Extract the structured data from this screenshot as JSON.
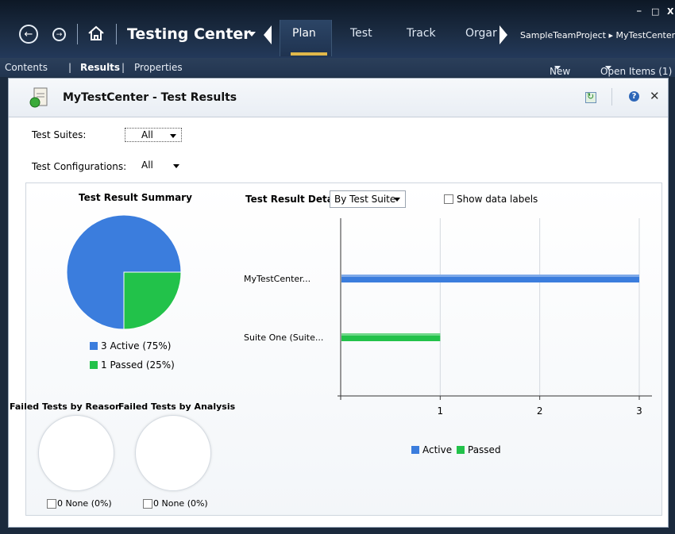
{
  "window": {
    "app_title": "Testing Center",
    "tabs": [
      {
        "label": "Plan",
        "active": true
      },
      {
        "label": "Test",
        "active": false
      },
      {
        "label": "Track",
        "active": false
      },
      {
        "label": "Orgar",
        "active": false
      }
    ],
    "breadcrumb": "SampleTeamProject ▸ MyTestCenter",
    "controls": {
      "minimize": "_",
      "maximize": "□",
      "close": "X"
    }
  },
  "subnav": {
    "items": [
      "Contents",
      "Results",
      "Properties"
    ],
    "selected": "Results",
    "new_label": "New",
    "open_items_label": "Open Items (1)"
  },
  "panel": {
    "title": "MyTestCenter - Test Results"
  },
  "filters": {
    "test_suites_label": "Test Suites:",
    "test_suites_value": "All",
    "test_configurations_label": "Test Configurations:",
    "test_configurations_value": "All"
  },
  "summary": {
    "title": "Test Result Summary",
    "legend": [
      {
        "label": "3 Active (75%)",
        "color": "#3b7ddd"
      },
      {
        "label": "1 Passed (25%)",
        "color": "#22c24a"
      }
    ]
  },
  "details": {
    "title": "Test Result Details",
    "group_by": "By Test Suite",
    "show_data_labels": "Show data labels",
    "legend": [
      {
        "label": "Active",
        "color": "#3b7ddd"
      },
      {
        "label": "Passed",
        "color": "#22c24a"
      }
    ]
  },
  "failed": {
    "by_reason_title": "Failed Tests by Reason",
    "by_analysis_title": "Failed Tests by Analysis",
    "by_reason_legend": "0 None (0%)",
    "by_analysis_legend": "0 None (0%)"
  },
  "chart_data": [
    {
      "type": "pie",
      "title": "Test Result Summary",
      "labels": [
        "Active",
        "Passed"
      ],
      "values": [
        3,
        1
      ],
      "colors": [
        "#3b7ddd",
        "#22c24a"
      ]
    },
    {
      "type": "bar",
      "orientation": "horizontal",
      "title": "Test Result Details",
      "categories": [
        "MyTestCenter...",
        "Suite One (Suite..."
      ],
      "series": [
        {
          "name": "Active",
          "values": [
            3,
            0
          ],
          "color": "#3b7ddd"
        },
        {
          "name": "Passed",
          "values": [
            0,
            1
          ],
          "color": "#22c24a"
        }
      ],
      "xlim": [
        0,
        3
      ],
      "xticks": [
        1,
        2,
        3
      ],
      "grid": true,
      "legend": "bottom"
    }
  ]
}
